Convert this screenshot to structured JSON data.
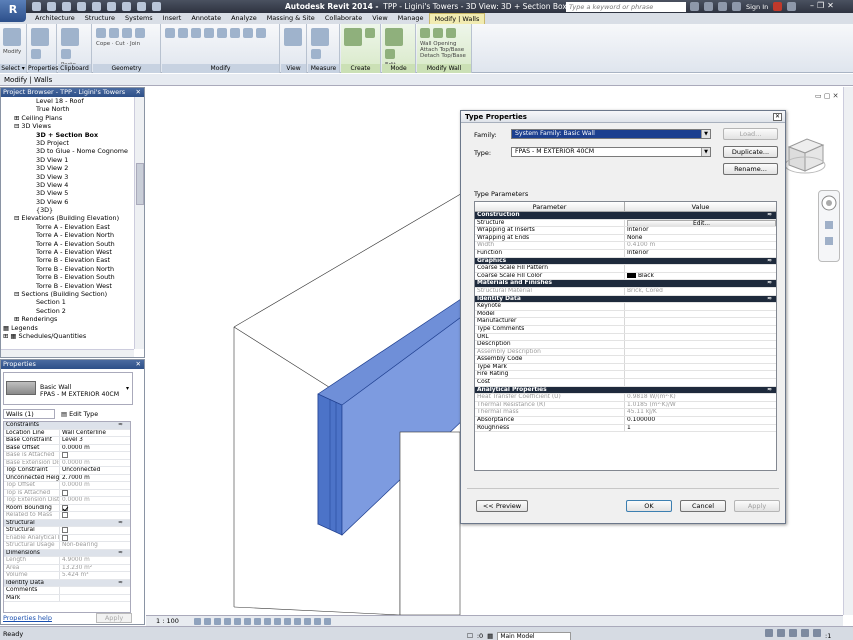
{
  "titlebar": {
    "app_button": "R",
    "title_app": "Autodesk Revit 2014 -",
    "title_doc": "TPP - Ligini's Towers - 3D View: 3D + Section Box",
    "search_placeholder": "Type a keyword or phrase",
    "sign_in": "Sign In"
  },
  "ribbon_tabs": [
    "Architecture",
    "Structure",
    "Systems",
    "Insert",
    "Annotate",
    "Analyze",
    "Massing & Site",
    "Collaborate",
    "View",
    "Manage",
    "Modify | Walls"
  ],
  "active_tab_index": 10,
  "ribbon_panels": [
    {
      "label": "Select ▾",
      "btn": "Modify"
    },
    {
      "label": "Properties",
      "btn": ""
    },
    {
      "label": "Clipboard",
      "btn": "Paste"
    },
    {
      "label": "Geometry",
      "btn": "Cope · Cut · Join"
    },
    {
      "label": "Modify",
      "btn": ""
    },
    {
      "label": "View",
      "btn": ""
    },
    {
      "label": "Measure",
      "btn": ""
    },
    {
      "label": "Create",
      "btn": ""
    },
    {
      "label": "Mode",
      "btn": "Edit Profile  Reset Profile"
    },
    {
      "label": "Modify Wall",
      "btn": "Wall Opening  Attach Top/Base  Detach Top/Base"
    }
  ],
  "context_label": "Modify | Walls",
  "project_browser": {
    "title": "Project Browser - TPP - Ligini's Towers",
    "items": [
      {
        "indent": 3,
        "text": "Level 18 - Roof"
      },
      {
        "indent": 3,
        "text": "True North"
      },
      {
        "indent": 1,
        "text": "⊞ Ceiling Plans"
      },
      {
        "indent": 1,
        "text": "⊟ 3D Views"
      },
      {
        "indent": 3,
        "text": "3D + Section Box",
        "sel": true
      },
      {
        "indent": 3,
        "text": "3D Project"
      },
      {
        "indent": 3,
        "text": "3D to Glue - Nome Cognome"
      },
      {
        "indent": 3,
        "text": "3D View 1"
      },
      {
        "indent": 3,
        "text": "3D View 2"
      },
      {
        "indent": 3,
        "text": "3D View 3"
      },
      {
        "indent": 3,
        "text": "3D View 4"
      },
      {
        "indent": 3,
        "text": "3D View 5"
      },
      {
        "indent": 3,
        "text": "3D View 6"
      },
      {
        "indent": 3,
        "text": "{3D}"
      },
      {
        "indent": 1,
        "text": "⊟ Elevations (Building Elevation)"
      },
      {
        "indent": 3,
        "text": "Torre A - Elevation East"
      },
      {
        "indent": 3,
        "text": "Torre A - Elevation North"
      },
      {
        "indent": 3,
        "text": "Torre A - Elevation South"
      },
      {
        "indent": 3,
        "text": "Torre A - Elevation West"
      },
      {
        "indent": 3,
        "text": "Torre B - Elevation East"
      },
      {
        "indent": 3,
        "text": "Torre B - Elevation North"
      },
      {
        "indent": 3,
        "text": "Torre B - Elevation South"
      },
      {
        "indent": 3,
        "text": "Torre B - Elevation West"
      },
      {
        "indent": 1,
        "text": "⊟ Sections (Building Section)"
      },
      {
        "indent": 3,
        "text": "Section 1"
      },
      {
        "indent": 3,
        "text": "Section 2"
      },
      {
        "indent": 1,
        "text": "⊞ Renderings"
      },
      {
        "indent": 0,
        "text": "▦ Legends"
      },
      {
        "indent": 0,
        "text": "⊞ ▦ Schedules/Quantities"
      }
    ],
    "scroll_fraction": 0.3
  },
  "properties": {
    "title": "Properties",
    "family_name": "Basic Wall",
    "type_name": "FPAS - M EXTERIOR 40CM",
    "instance_filter": "Walls (1)",
    "edit_type": "Edit Type",
    "rows": [
      {
        "grp": true,
        "k": "Constraints",
        "v": "≈"
      },
      {
        "k": "Location Line",
        "v": "Wall Centerline"
      },
      {
        "k": "Base Constraint",
        "v": "Level 3"
      },
      {
        "k": "Base Offset",
        "v": "0.0000 m"
      },
      {
        "k": "Base is Attached",
        "v": "",
        "dis": true,
        "chk": false
      },
      {
        "k": "Base Extension Dis...",
        "v": "0.0000 m",
        "dis": true
      },
      {
        "k": "Top Constraint",
        "v": "Unconnected"
      },
      {
        "k": "Unconnected Height",
        "v": "2.7000 m"
      },
      {
        "k": "Top Offset",
        "v": "0.0000 m",
        "dis": true
      },
      {
        "k": "Top is Attached",
        "v": "",
        "dis": true,
        "chk": false
      },
      {
        "k": "Top Extension Dist...",
        "v": "0.0000 m",
        "dis": true
      },
      {
        "k": "Room Bounding",
        "v": "",
        "chk": true
      },
      {
        "k": "Related to Mass",
        "v": "",
        "dis": true,
        "chk": false
      },
      {
        "grp": true,
        "k": "Structural",
        "v": "≈"
      },
      {
        "k": "Structural",
        "v": "",
        "chk": false
      },
      {
        "k": "Enable Analytical M...",
        "v": "",
        "dis": true,
        "chk": false
      },
      {
        "k": "Structural Usage",
        "v": "Non-bearing",
        "dis": true
      },
      {
        "grp": true,
        "k": "Dimensions",
        "v": "≈"
      },
      {
        "k": "Length",
        "v": "4.9000 m",
        "dis": true
      },
      {
        "k": "Area",
        "v": "13.230 m²",
        "dis": true
      },
      {
        "k": "Volume",
        "v": "5.424 m³",
        "dis": true
      },
      {
        "grp": true,
        "k": "Identity Data",
        "v": "≈"
      },
      {
        "k": "Comments",
        "v": ""
      },
      {
        "k": "Mark",
        "v": ""
      }
    ],
    "help": "Properties help",
    "apply": "Apply"
  },
  "view": {
    "scale": "1 : 100",
    "controls": "▭ ▢ ✕"
  },
  "dialog": {
    "title": "Type Properties",
    "family_label": "Family:",
    "family_value": "System Family: Basic Wall",
    "type_label": "Type:",
    "type_value": "FPAS - M EXTERIOR 40CM",
    "load": "Load...",
    "duplicate": "Duplicate...",
    "rename": "Rename...",
    "type_params_label": "Type Parameters",
    "col_param": "Parameter",
    "col_value": "Value",
    "rows": [
      {
        "grp": true,
        "k": "Construction",
        "v": "≈"
      },
      {
        "k": "Structure",
        "v": "Edit...",
        "btn": true
      },
      {
        "k": "Wrapping at Inserts",
        "v": "Interior"
      },
      {
        "k": "Wrapping at Ends",
        "v": "None"
      },
      {
        "k": "Width",
        "v": "0.4100 m",
        "dis": true
      },
      {
        "k": "Function",
        "v": "Interior"
      },
      {
        "grp": true,
        "k": "Graphics",
        "v": "≈"
      },
      {
        "k": "Coarse Scale Fill Pattern",
        "v": ""
      },
      {
        "k": "Coarse Scale Fill Color",
        "v": "Black",
        "color": true
      },
      {
        "grp": true,
        "k": "Materials and Finishes",
        "v": "≈"
      },
      {
        "k": "Structural Material",
        "v": "Brick, Cored",
        "dis": true
      },
      {
        "grp": true,
        "k": "Identity Data",
        "v": "≈"
      },
      {
        "k": "Keynote",
        "v": ""
      },
      {
        "k": "Model",
        "v": ""
      },
      {
        "k": "Manufacturer",
        "v": ""
      },
      {
        "k": "Type Comments",
        "v": ""
      },
      {
        "k": "URL",
        "v": ""
      },
      {
        "k": "Description",
        "v": ""
      },
      {
        "k": "Assembly Description",
        "v": "",
        "dis": true
      },
      {
        "k": "Assembly Code",
        "v": ""
      },
      {
        "k": "Type Mark",
        "v": ""
      },
      {
        "k": "Fire Rating",
        "v": ""
      },
      {
        "k": "Cost",
        "v": ""
      },
      {
        "grp": true,
        "k": "Analytical Properties",
        "v": "≈"
      },
      {
        "k": "Heat Transfer Coefficient (U)",
        "v": "0.9818 W/(m²·K)",
        "dis": true
      },
      {
        "k": "Thermal Resistance (R)",
        "v": "1.0185 (m²·K)/W",
        "dis": true
      },
      {
        "k": "Thermal mass",
        "v": "45.11 kJ/K",
        "dis": true
      },
      {
        "k": "Absorptance",
        "v": "0.100000"
      },
      {
        "k": "Roughness",
        "v": "1"
      }
    ],
    "preview": "<< Preview",
    "ok": "OK",
    "cancel": "Cancel",
    "apply": "Apply"
  },
  "statusbar": {
    "ready": "Ready",
    "zero": ":0",
    "model": "Main Model",
    "filter": ":1"
  },
  "colors": {
    "wall_fill": "#6f8fd8",
    "wall_face": "#4c73c8",
    "selection_blue": "#1c3f8f",
    "ribbon_highlight": "#cbe0b5"
  }
}
